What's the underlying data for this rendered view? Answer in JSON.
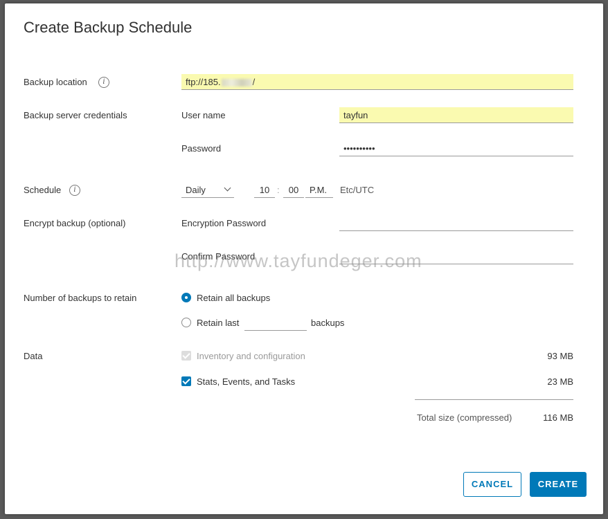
{
  "dialog": {
    "title": "Create Backup Schedule"
  },
  "backup_location": {
    "label": "Backup location",
    "value_prefix": "ftp://185.",
    "value_suffix": "/"
  },
  "credentials": {
    "label": "Backup server credentials",
    "username_label": "User name",
    "username_value": "tayfun",
    "password_label": "Password",
    "password_value": "••••••••••"
  },
  "schedule": {
    "label": "Schedule",
    "frequency": "Daily",
    "hour": "10",
    "separator": ":",
    "minute": "00",
    "ampm": "P.M.",
    "timezone": "Etc/UTC"
  },
  "encrypt": {
    "label": "Encrypt backup (optional)",
    "password_label": "Encryption Password",
    "confirm_label": "Confirm Password"
  },
  "watermark": "http://www.tayfundeger.com",
  "retain": {
    "label": "Number of backups to retain",
    "option_all": "Retain all backups",
    "option_last": "Retain last",
    "option_last_suffix": "backups",
    "selected": "all"
  },
  "data": {
    "label": "Data",
    "items": [
      {
        "label": "Inventory and configuration",
        "size": "93 MB",
        "checked": true,
        "disabled": true
      },
      {
        "label": "Stats, Events, and Tasks",
        "size": "23 MB",
        "checked": true,
        "disabled": false
      }
    ],
    "total_label": "Total size (compressed)",
    "total_size": "116 MB"
  },
  "buttons": {
    "cancel": "CANCEL",
    "create": "CREATE"
  },
  "colors": {
    "accent": "#0079b8",
    "field_highlight": "#fafab0"
  }
}
